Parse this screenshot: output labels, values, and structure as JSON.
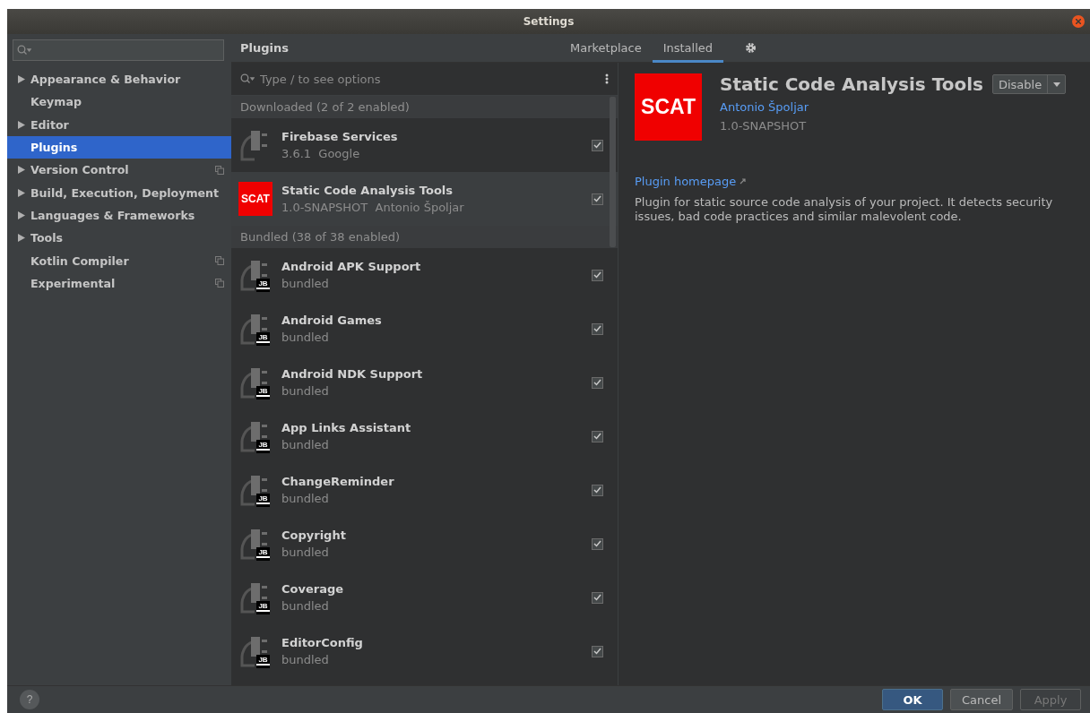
{
  "window": {
    "title": "Settings"
  },
  "sidebar": {
    "items": [
      {
        "label": "Appearance & Behavior",
        "expandable": true,
        "selected": false,
        "project_level": false
      },
      {
        "label": "Keymap",
        "expandable": false,
        "selected": false,
        "project_level": false
      },
      {
        "label": "Editor",
        "expandable": true,
        "selected": false,
        "project_level": false
      },
      {
        "label": "Plugins",
        "expandable": false,
        "selected": true,
        "project_level": false
      },
      {
        "label": "Version Control",
        "expandable": true,
        "selected": false,
        "project_level": true
      },
      {
        "label": "Build, Execution, Deployment",
        "expandable": true,
        "selected": false,
        "project_level": false
      },
      {
        "label": "Languages & Frameworks",
        "expandable": true,
        "selected": false,
        "project_level": false
      },
      {
        "label": "Tools",
        "expandable": true,
        "selected": false,
        "project_level": false
      },
      {
        "label": "Kotlin Compiler",
        "expandable": false,
        "selected": false,
        "project_level": true
      },
      {
        "label": "Experimental",
        "expandable": false,
        "selected": false,
        "project_level": true
      }
    ]
  },
  "header": {
    "title": "Plugins",
    "tabs": [
      {
        "label": "Marketplace",
        "selected": false
      },
      {
        "label": "Installed",
        "selected": true
      }
    ]
  },
  "plugin_search": {
    "placeholder": "Type / to see options"
  },
  "groups": [
    {
      "title": "Downloaded (2 of 2 enabled)",
      "plugins": [
        {
          "name": "Firebase Services",
          "details": [
            "3.6.1",
            "Google"
          ],
          "kind": "plugin",
          "checked": true,
          "selected": false
        },
        {
          "name": "Static Code Analysis Tools",
          "details": [
            "1.0-SNAPSHOT",
            "Antonio Špoljar"
          ],
          "kind": "logo",
          "logo_text": "SCAT",
          "checked": true,
          "selected": true
        }
      ]
    },
    {
      "title": "Bundled (38 of 38 enabled)",
      "plugins": [
        {
          "name": "Android APK Support",
          "details": [
            "bundled"
          ],
          "kind": "plugin",
          "badge": "JB",
          "checked": true,
          "selected": false
        },
        {
          "name": "Android Games",
          "details": [
            "bundled"
          ],
          "kind": "plugin",
          "badge": "JB",
          "checked": true,
          "selected": false
        },
        {
          "name": "Android NDK Support",
          "details": [
            "bundled"
          ],
          "kind": "plugin",
          "badge": "JB",
          "checked": true,
          "selected": false
        },
        {
          "name": "App Links Assistant",
          "details": [
            "bundled"
          ],
          "kind": "plugin",
          "badge": "JB",
          "checked": true,
          "selected": false
        },
        {
          "name": "ChangeReminder",
          "details": [
            "bundled"
          ],
          "kind": "plugin",
          "badge": "JB",
          "checked": true,
          "selected": false
        },
        {
          "name": "Copyright",
          "details": [
            "bundled"
          ],
          "kind": "plugin",
          "badge": "JB",
          "checked": true,
          "selected": false
        },
        {
          "name": "Coverage",
          "details": [
            "bundled"
          ],
          "kind": "plugin",
          "badge": "JB",
          "checked": true,
          "selected": false
        },
        {
          "name": "EditorConfig",
          "details": [
            "bundled"
          ],
          "kind": "plugin",
          "badge": "JB",
          "checked": true,
          "selected": false
        }
      ]
    }
  ],
  "detail": {
    "logo_text": "SCAT",
    "title": "Static Code Analysis Tools",
    "action": "Disable",
    "vendor": "Antonio Špoljar",
    "version": "1.0-SNAPSHOT",
    "homepage": "Plugin homepage",
    "description": "Plugin for static source code analysis of your project. It detects security issues, bad code practices and similar malevolent code."
  },
  "footer": {
    "help": "?",
    "buttons": [
      {
        "label": "OK",
        "kind": "default",
        "disabled": false
      },
      {
        "label": "Cancel",
        "kind": "normal",
        "disabled": false
      },
      {
        "label": "Apply",
        "kind": "normal",
        "disabled": true
      }
    ]
  }
}
